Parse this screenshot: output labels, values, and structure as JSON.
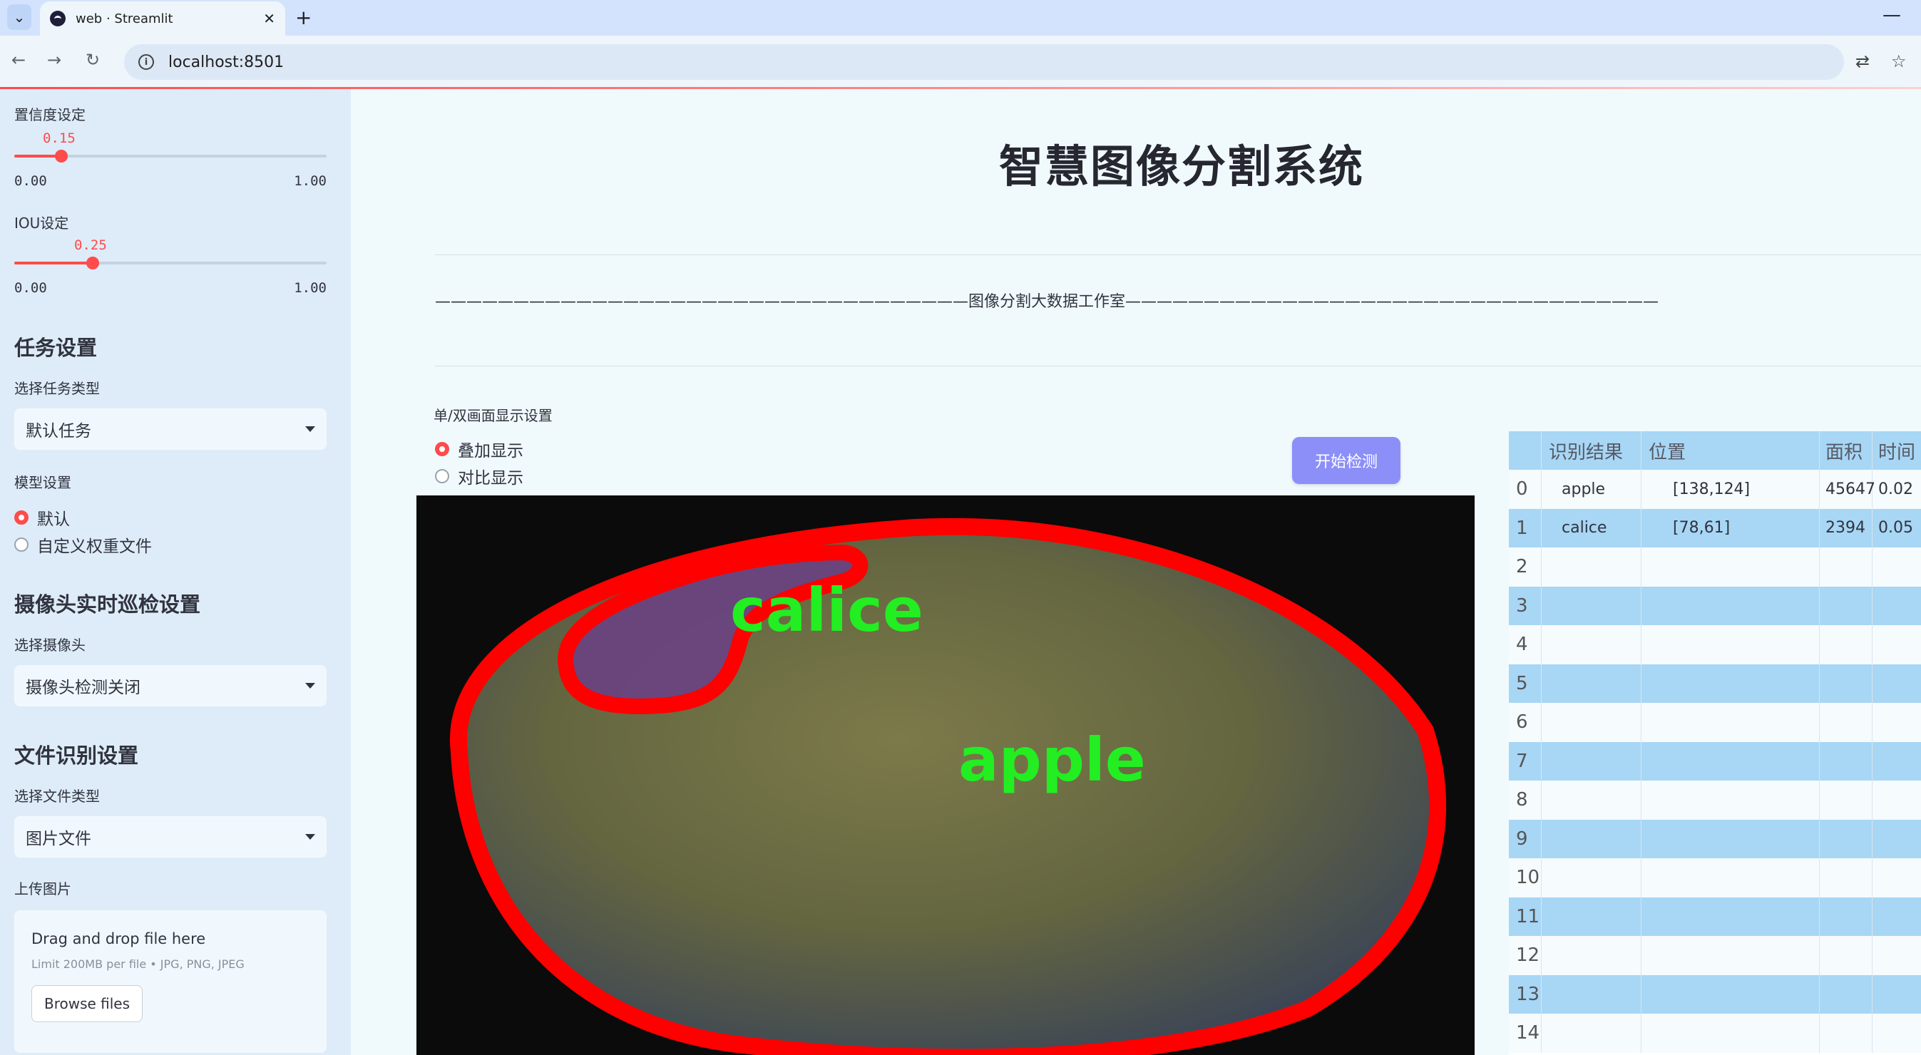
{
  "browser": {
    "tab_title": "web · Streamlit",
    "url": "localhost:8501"
  },
  "sidebar": {
    "confidence": {
      "label": "置信度设定",
      "value_text": "0.15",
      "value": 0.15,
      "min": "0.00",
      "max": "1.00"
    },
    "iou": {
      "label": "IOU设定",
      "value_text": "0.25",
      "value": 0.25,
      "min": "0.00",
      "max": "1.00"
    },
    "task_header": "任务设置",
    "task_type_label": "选择任务类型",
    "task_type_value": "默认任务",
    "model_label": "模型设置",
    "model_options": [
      "默认",
      "自定义权重文件"
    ],
    "camera_header": "摄像头实时巡检设置",
    "camera_label": "选择摄像头",
    "camera_value": "摄像头检测关闭",
    "file_header": "文件识别设置",
    "file_type_label": "选择文件类型",
    "file_type_value": "图片文件",
    "upload_label": "上传图片",
    "upload": {
      "drag_text": "Drag and drop file here",
      "limit_text": "Limit 200MB per file • JPG, PNG, JPEG",
      "browse_label": "Browse files"
    }
  },
  "main": {
    "title": "智慧图像分割系统",
    "banner": "——————————————————————————————————图像分割大数据工作室——————————————————————————————————",
    "display_label": "单/双画面显示设置",
    "display_options": [
      "叠加显示",
      "对比显示"
    ],
    "detect_button": "开始检测",
    "image_labels": {
      "calice": "calice",
      "apple": "apple"
    }
  },
  "table": {
    "headers": [
      "",
      "识别结果",
      "位置",
      "面积",
      "时间"
    ],
    "rows": [
      [
        "0",
        "apple",
        "[138,124]",
        "45647",
        "0.02"
      ],
      [
        "1",
        "calice",
        "[78,61]",
        "2394",
        "0.05"
      ],
      [
        "2",
        "",
        "",
        "",
        ""
      ],
      [
        "3",
        "",
        "",
        "",
        ""
      ],
      [
        "4",
        "",
        "",
        "",
        ""
      ],
      [
        "5",
        "",
        "",
        "",
        ""
      ],
      [
        "6",
        "",
        "",
        "",
        ""
      ],
      [
        "7",
        "",
        "",
        "",
        ""
      ],
      [
        "8",
        "",
        "",
        "",
        ""
      ],
      [
        "9",
        "",
        "",
        "",
        ""
      ],
      [
        "10",
        "",
        "",
        "",
        ""
      ],
      [
        "11",
        "",
        "",
        "",
        ""
      ],
      [
        "12",
        "",
        "",
        "",
        ""
      ],
      [
        "13",
        "",
        "",
        "",
        ""
      ],
      [
        "14",
        "",
        "",
        "",
        ""
      ]
    ]
  },
  "colors": {
    "accent": "#ff4b4b",
    "button": "#8c8ff8",
    "table_stripe": "#a8d6f5",
    "mask_outline": "#ff0000",
    "label_green": "#22ee22"
  }
}
